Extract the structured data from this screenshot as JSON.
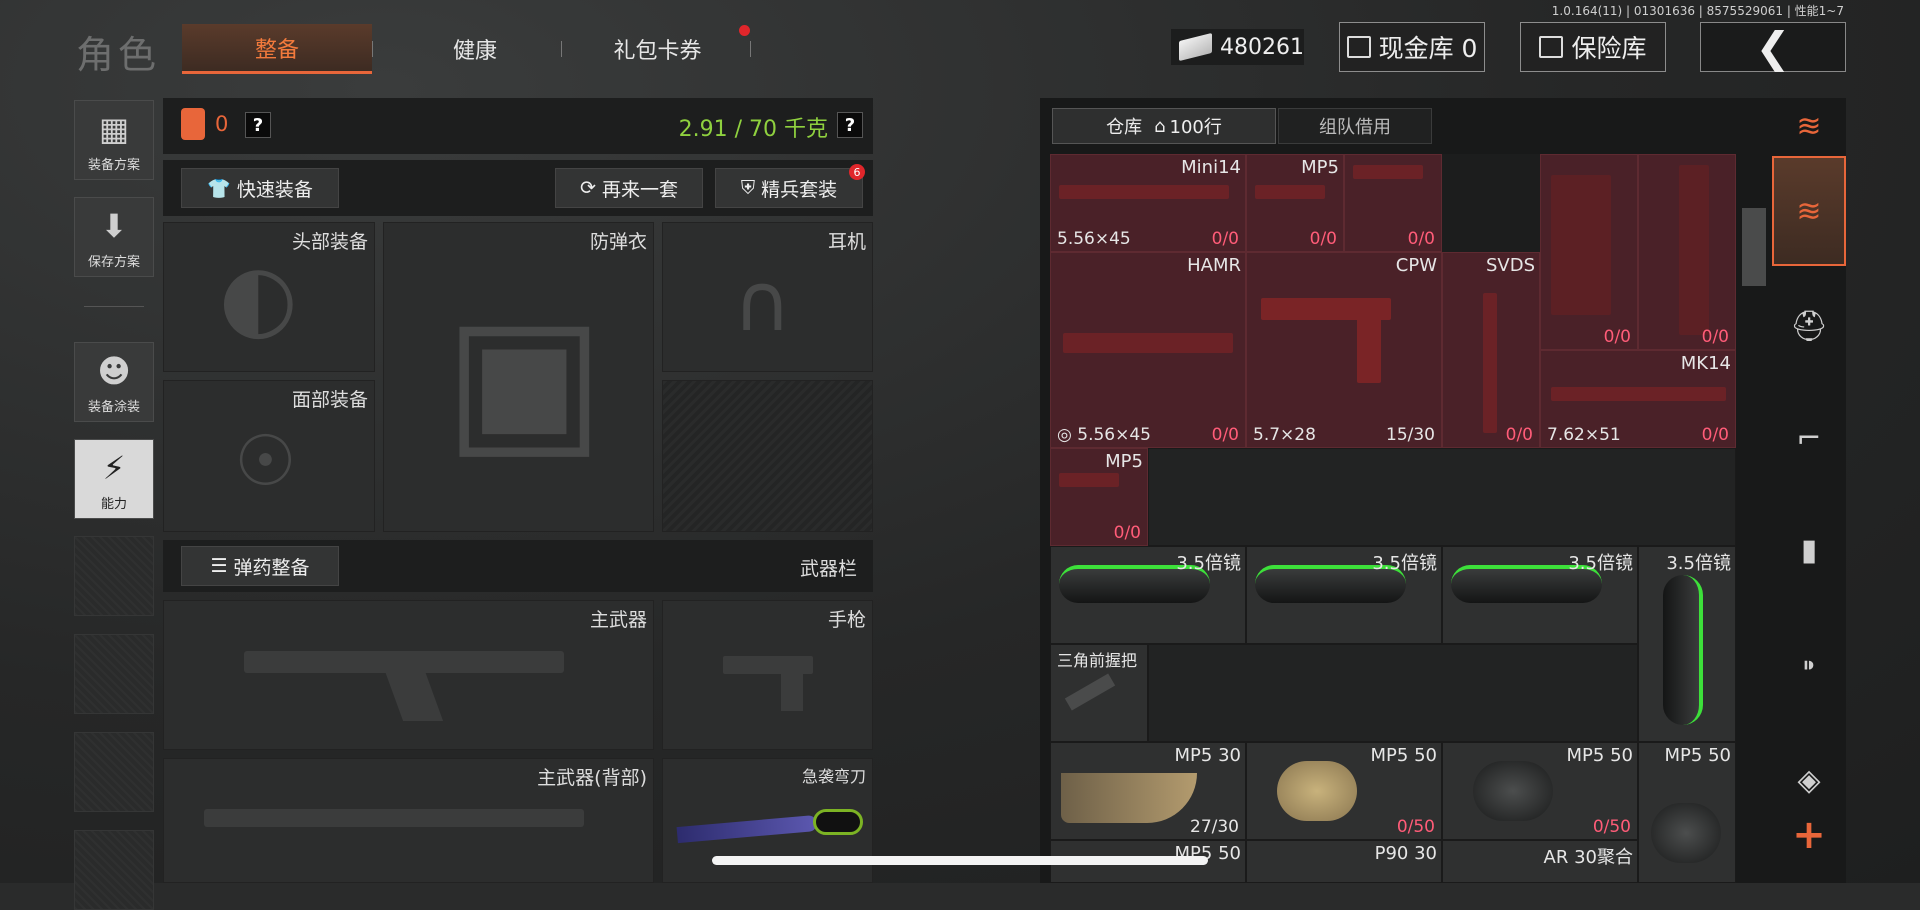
{
  "version": "1.0.164(11) | 01301636 | 8575529061 | 性能1~7",
  "page_title": "角色",
  "tabs": [
    {
      "label": "整备",
      "active": true
    },
    {
      "label": "健康",
      "active": false
    },
    {
      "label": "礼包卡券",
      "active": false
    }
  ],
  "currency": {
    "cash": "480261",
    "cash_vault": "现金库 0",
    "insurance": "保险库"
  },
  "back": "❮",
  "left_sidebar": [
    {
      "label": "装备方案",
      "icon": "vest-icon",
      "glyph": "▦"
    },
    {
      "label": "保存方案",
      "icon": "download-icon",
      "glyph": "⬇"
    },
    {
      "label": "装备涂装",
      "icon": "helmet-paint-icon",
      "glyph": "☻"
    },
    {
      "label": "能力",
      "icon": "ability-bolt-icon",
      "glyph": "⚡"
    }
  ],
  "loadout": {
    "armor_count": "0",
    "weight": "2.91 / 70 千克",
    "help": "?",
    "quick_equip": "快速装备",
    "again": "再来一套",
    "elite": "精兵套装",
    "elite_badge": "6",
    "ammo_equip": "弹药整备",
    "weapon_bar": "武器栏"
  },
  "slots": {
    "head": "头部装备",
    "body_armor": "防弹衣",
    "headset": "耳机",
    "face": "面部装备",
    "primary": "主武器",
    "pistol": "手枪",
    "primary_back": "主武器(背部)",
    "knife": "急袭弯刀"
  },
  "inventory": {
    "tab_warehouse": "仓库",
    "rows": "100行",
    "tab_team": "组队借用",
    "items": [
      {
        "name": "Mini14",
        "caliber": "5.56×45",
        "count": "0/0"
      },
      {
        "name": "MP5",
        "caliber": "",
        "count": "0/0"
      },
      {
        "name": "",
        "caliber": "",
        "count": "0/0"
      },
      {
        "name": "HAMR",
        "caliber": "5.56×45",
        "count": "0/0"
      },
      {
        "name": "CPW",
        "caliber": "5.7×28",
        "count": "15/30"
      },
      {
        "name": "SVDS",
        "caliber": "",
        "count": "0/0"
      },
      {
        "name": "",
        "caliber": "",
        "count": "0/0"
      },
      {
        "name": "",
        "caliber": "",
        "count": "0/0"
      },
      {
        "name": "MK14",
        "caliber": "7.62×51",
        "count": "0/0"
      },
      {
        "name": "MP5",
        "caliber": "",
        "count": "0/0"
      },
      {
        "name": "3.5倍镜",
        "caliber": "",
        "count": ""
      },
      {
        "name": "3.5倍镜",
        "caliber": "",
        "count": ""
      },
      {
        "name": "3.5倍镜",
        "caliber": "",
        "count": ""
      },
      {
        "name": "3.5倍镜",
        "caliber": "",
        "count": ""
      },
      {
        "name": "三角前握把",
        "caliber": "",
        "count": ""
      },
      {
        "name": "MP5 30",
        "caliber": "",
        "count": "27/30"
      },
      {
        "name": "MP5 50",
        "caliber": "",
        "count": "0/50"
      },
      {
        "name": "MP5 50",
        "caliber": "",
        "count": "0/50"
      },
      {
        "name": "MP5 50",
        "caliber": "",
        "count": ""
      },
      {
        "name": "MP5 50",
        "caliber": "",
        "count": ""
      },
      {
        "name": "P90 30",
        "caliber": "",
        "count": ""
      },
      {
        "name": "AR 30聚合",
        "caliber": "",
        "count": ""
      }
    ]
  },
  "right_sidebar": [
    {
      "icon": "stack-refresh-icon",
      "glyph": "≋",
      "active": false
    },
    {
      "icon": "stack-down-icon",
      "glyph": "≋",
      "active": true
    },
    {
      "icon": "helmet-icon",
      "glyph": "⛑",
      "active": false
    },
    {
      "icon": "rifle-icon",
      "glyph": "⌐",
      "active": false
    },
    {
      "icon": "magazine-icon",
      "glyph": "▮",
      "active": false
    },
    {
      "icon": "bullet-icon",
      "glyph": "⁍",
      "active": false
    },
    {
      "icon": "sight-icon",
      "glyph": "◈",
      "active": false
    },
    {
      "icon": "add-icon",
      "glyph": "+",
      "active": false
    }
  ],
  "colors": {
    "accent": "#e8663a",
    "weight_green": "#8fd13f",
    "count_red": "#ff5c78"
  }
}
